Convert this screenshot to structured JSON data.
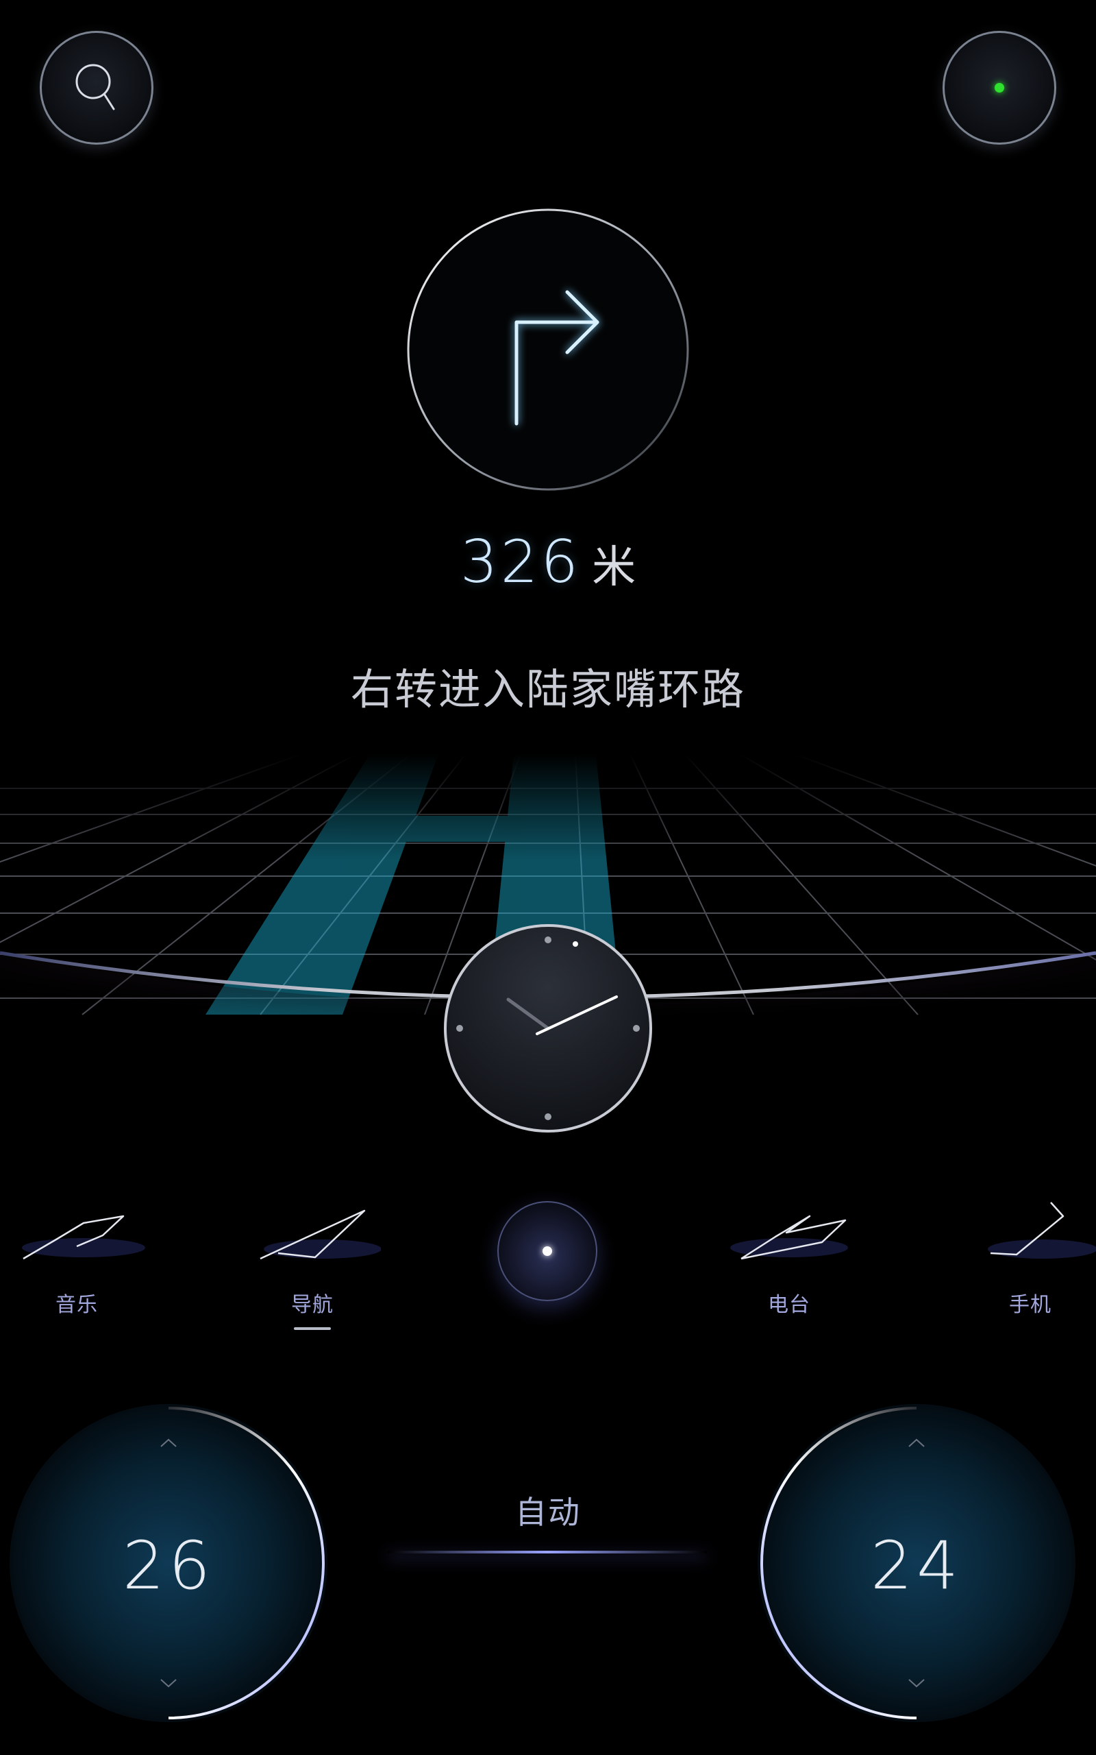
{
  "top_bar": {
    "search_icon": "search-icon",
    "status_indicator_color": "#2fe02f"
  },
  "navigation": {
    "turn_icon": "turn-right-arrow-icon",
    "distance_value": "326",
    "distance_unit": "米",
    "instruction": "右转进入陆家嘴环路"
  },
  "clock": {
    "hour": 9,
    "minute": 12
  },
  "dock": {
    "items": [
      {
        "label": "音乐",
        "icon": "music-icon"
      },
      {
        "label": "导航",
        "icon": "navigation-icon",
        "active": true
      },
      {
        "label": "",
        "icon": "home-dot-icon"
      },
      {
        "label": "电台",
        "icon": "radio-icon"
      },
      {
        "label": "手机",
        "icon": "phone-icon"
      }
    ]
  },
  "climate": {
    "left_temp": "26",
    "right_temp": "24",
    "mode": "自动"
  },
  "colors": {
    "accent": "#9aa4ff",
    "route": "#1bb3d6",
    "temp_glow": "#0f3a55"
  }
}
